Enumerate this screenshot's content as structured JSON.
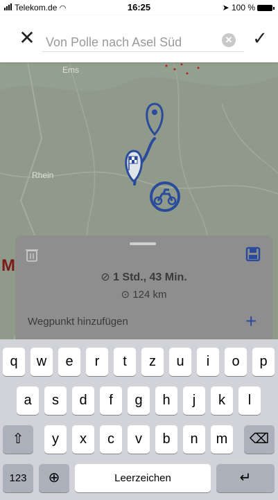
{
  "status_bar": {
    "carrier": "Telekom.de",
    "time": "16:25",
    "battery": "100 %"
  },
  "title_bar": {
    "route_name": "Von Polle nach Asel Süd"
  },
  "map": {
    "labels": [
      "Ems",
      "Rhein"
    ]
  },
  "route_panel": {
    "duration": "1 Std., 43 Min.",
    "distance": "124 km",
    "add_waypoint_label": "Wegpunkt hinzufügen",
    "accent_color": "#2a4a9c"
  },
  "keyboard": {
    "row1": [
      "q",
      "w",
      "e",
      "r",
      "t",
      "z",
      "u",
      "i",
      "o",
      "p"
    ],
    "row2": [
      "a",
      "s",
      "d",
      "f",
      "g",
      "h",
      "j",
      "k",
      "l"
    ],
    "row3": [
      "y",
      "x",
      "c",
      "v",
      "b",
      "n",
      "m"
    ],
    "numbers_label": "123",
    "space_label": "Leerzeichen"
  }
}
